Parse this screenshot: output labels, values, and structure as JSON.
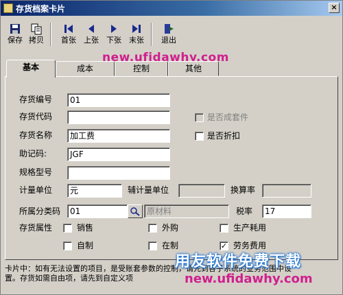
{
  "window": {
    "title": "存货档案卡片",
    "close_glyph": "×"
  },
  "toolbar": [
    {
      "name": "save",
      "label": "保存",
      "icon": "floppy-disk-icon"
    },
    {
      "name": "copy",
      "label": "拷贝",
      "icon": "copy-icon"
    },
    {
      "name": "first",
      "label": "首张",
      "icon": "first-record-icon"
    },
    {
      "name": "prev",
      "label": "上张",
      "icon": "previous-record-icon"
    },
    {
      "name": "next",
      "label": "下张",
      "icon": "next-record-icon"
    },
    {
      "name": "last",
      "label": "末张",
      "icon": "last-record-icon"
    },
    {
      "name": "exit",
      "label": "退出",
      "icon": "exit-door-icon"
    }
  ],
  "watermark_top": "new.ufidawhy.com",
  "tabs": [
    {
      "label": "基本",
      "active": true
    },
    {
      "label": "成本",
      "active": false
    },
    {
      "label": "控制",
      "active": false
    },
    {
      "label": "其他",
      "active": false
    }
  ],
  "form": {
    "code_label": "存货编号",
    "code_value": "01",
    "daima_label": "存货代码",
    "daima_value": "",
    "name_label": "存货名称",
    "name_value": "加工费",
    "mnemonic_label": "助记码:",
    "mnemonic_value": "JGF",
    "spec_label": "规格型号",
    "spec_value": "",
    "unit_label": "计量单位",
    "unit_value": "元",
    "aux_unit_label": "辅计量单位",
    "aux_unit_value": "",
    "conv_label": "换算率",
    "conv_value": "",
    "category_label": "所属分类码",
    "category_value": "01",
    "category_name": "原材料",
    "tax_label": "税率",
    "tax_value": "17",
    "attr_label": "存货属性",
    "is_kit_label": "是否成套件",
    "is_kit_checked": false,
    "is_discount_label": "是否折扣",
    "is_discount_checked": false,
    "attrs": [
      {
        "label": "销售",
        "checked": false
      },
      {
        "label": "外购",
        "checked": false
      },
      {
        "label": "生产耗用",
        "checked": false
      },
      {
        "label": "自制",
        "checked": false
      },
      {
        "label": "在制",
        "checked": false
      },
      {
        "label": "劳务费用",
        "checked": true
      }
    ],
    "check_glyph": "✓"
  },
  "status_text": "卡片中：如有无法设置的项目，是受账套参数的控制，请先到各子系统的业务范围中设置。存货如需自由项，请先到自定义项",
  "watermark_bottom_cn": "用友软件免费下载",
  "watermark_bottom_url": "new.ufidawhy.com"
}
